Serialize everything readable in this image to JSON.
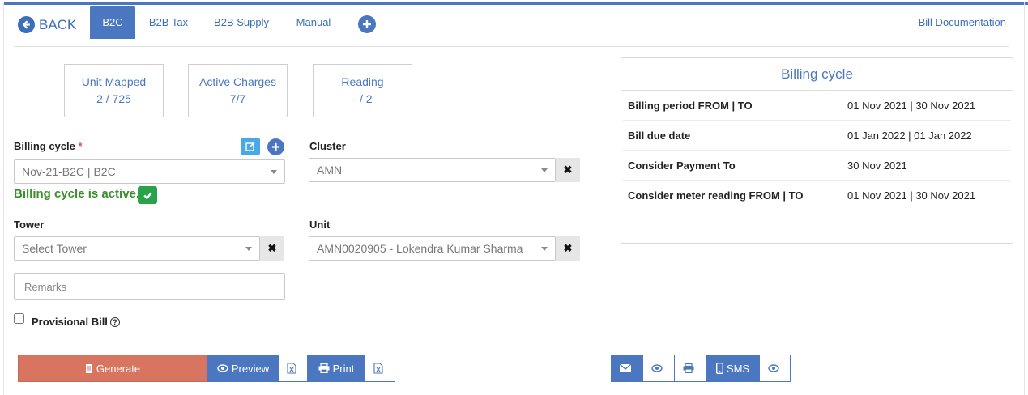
{
  "nav": {
    "back_label": "BACK",
    "tabs": [
      {
        "label": "B2C",
        "active": true
      },
      {
        "label": "B2B Tax",
        "active": false
      },
      {
        "label": "B2B Supply",
        "active": false
      },
      {
        "label": "Manual",
        "active": false
      }
    ],
    "doc_link": "Bill Documentation"
  },
  "stats": [
    {
      "label": "Unit Mapped",
      "value": "2 / 725"
    },
    {
      "label": "Active Charges",
      "value": "7/7"
    },
    {
      "label": "Reading",
      "value": "- / 2"
    }
  ],
  "form": {
    "billing_cycle": {
      "label": "Billing cycle",
      "required_mark": "*",
      "value": "Nov-21-B2C | B2C"
    },
    "billing_active_msg": "Billing cycle is active.",
    "cluster": {
      "label": "Cluster",
      "value": "AMN"
    },
    "tower": {
      "label": "Tower",
      "value": "Select Tower"
    },
    "unit": {
      "label": "Unit",
      "value": "AMN0020905 - Lokendra Kumar Sharma"
    },
    "remarks_placeholder": "Remarks",
    "provisional_label": "Provisional Bill",
    "provisional_help": "?"
  },
  "billing_panel": {
    "title": "Billing cycle",
    "rows": [
      {
        "key": "Billing period FROM | TO",
        "value": "01 Nov 2021 | 30 Nov 2021"
      },
      {
        "key": "Bill due date",
        "value": "01 Jan 2022 | 01 Jan 2022"
      },
      {
        "key": "Consider Payment To",
        "value": "30 Nov 2021"
      },
      {
        "key": "Consider meter reading FROM | TO",
        "value": "01 Nov 2021 | 30 Nov 2021"
      }
    ]
  },
  "actions": {
    "generate": "Generate",
    "preview": "Preview",
    "print": "Print",
    "sms": "SMS"
  },
  "colors": {
    "primary": "#4a77c0",
    "generate": "#d87560",
    "success": "#2aa24a",
    "success_text": "#3c8f2e"
  }
}
